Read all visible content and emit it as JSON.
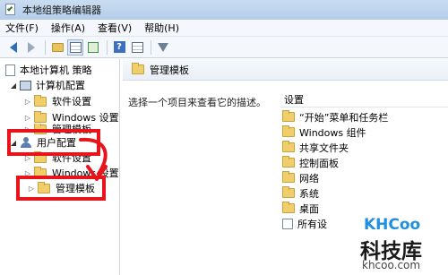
{
  "window": {
    "title": "本地组策略编辑器"
  },
  "menu": [
    "文件(F)",
    "操作(A)",
    "查看(V)",
    "帮助(H)"
  ],
  "toolbar": {
    "icons": [
      "back-arrow-icon",
      "forward-arrow-icon",
      "up-folder-icon",
      "show-hide-tree-icon",
      "export-list-icon",
      "help-icon",
      "view-icon",
      "filter-icon"
    ]
  },
  "tree": {
    "root": "本地计算机 策略",
    "computer_config": "计算机配置",
    "software_settings_1": "软件设置",
    "windows_settings_1": "Windows 设置",
    "admin_templates_1": "管理模板",
    "user_config": "用户配置",
    "software_settings_2": "软件设置",
    "windows_settings_2": "Windows 设置",
    "admin_templates_2": "管理模板"
  },
  "right": {
    "header": "管理模板",
    "description": "选择一个项目来查看它的描述。",
    "column_header": "设置",
    "items": [
      "“开始”菜单和任务栏",
      "Windows 组件",
      "共享文件夹",
      "控制面板",
      "网络",
      "系统",
      "桌面",
      "所有设"
    ]
  },
  "watermark": {
    "brand": "KHCoo",
    "name": "科技库",
    "domain": "khcoo.com"
  },
  "colors": {
    "highlight": "#e8141c",
    "watermark_blue": "#1f8fe0"
  }
}
